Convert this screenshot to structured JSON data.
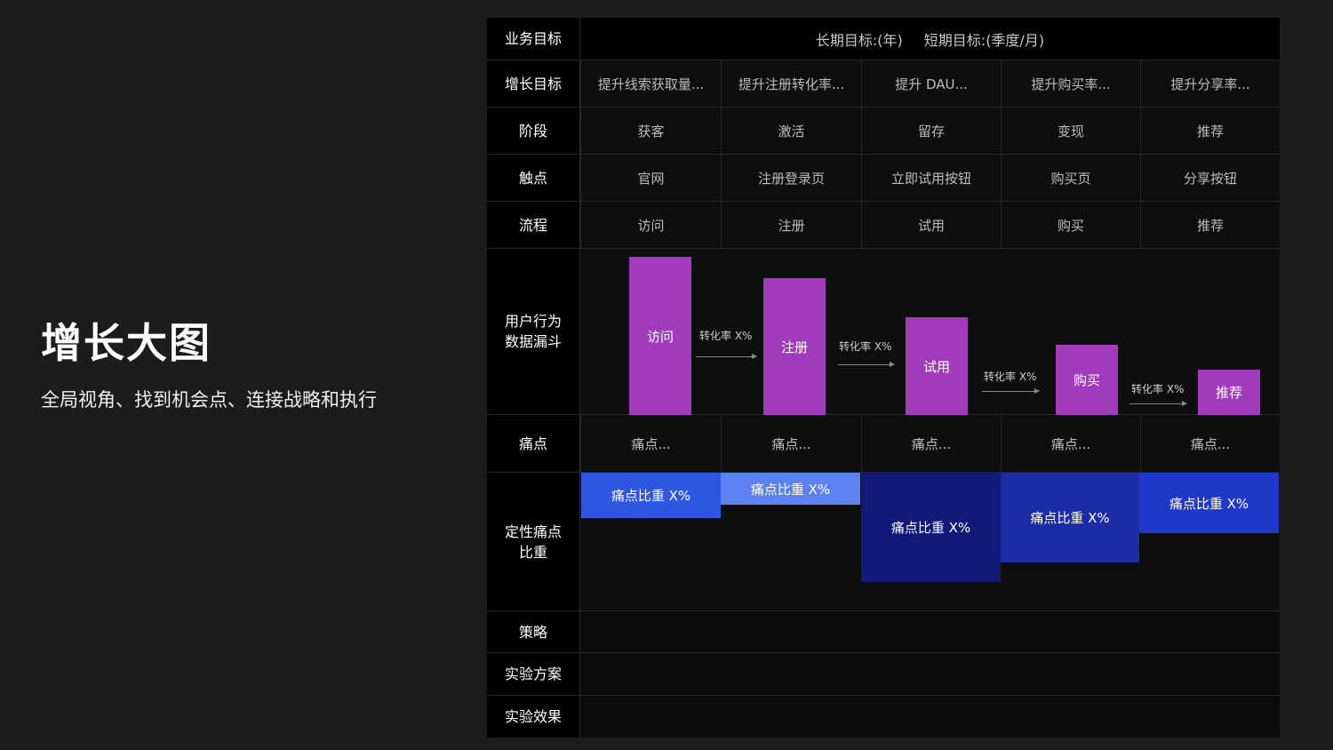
{
  "title": "增长大图",
  "subtitle": "全局视角、找到机会点、连接战略和执行",
  "rows": {
    "biz_goal": {
      "label": "业务目标",
      "long_term": "长期目标:(年)",
      "short_term": "短期目标:(季度/月)"
    },
    "growth_goal": {
      "label": "增长目标",
      "cells": [
        "提升线索获取量...",
        "提升注册转化率...",
        "提升 DAU...",
        "提升购买率...",
        "提升分享率..."
      ]
    },
    "stage": {
      "label": "阶段",
      "cells": [
        "获客",
        "激活",
        "留存",
        "变现",
        "推荐"
      ]
    },
    "touchpoint": {
      "label": "触点",
      "cells": [
        "官网",
        "注册登录页",
        "立即试用按钮",
        "购买页",
        "分享按钮"
      ]
    },
    "flow": {
      "label": "流程",
      "cells": [
        "访问",
        "注册",
        "试用",
        "购买",
        "推荐"
      ]
    },
    "funnel": {
      "label": "用户行为\n数据漏斗",
      "bars": [
        "访问",
        "注册",
        "试用",
        "购买",
        "推荐"
      ],
      "conversion_label": "转化率 X%"
    },
    "pain": {
      "label": "痛点",
      "cells": [
        "痛点...",
        "痛点...",
        "痛点...",
        "痛点...",
        "痛点..."
      ]
    },
    "pain_ratio": {
      "label": "定性痛点\n比重",
      "block_text": "痛点比重 X%"
    },
    "strategy": {
      "label": "策略"
    },
    "experiment_plan": {
      "label": "实验方案"
    },
    "experiment_result": {
      "label": "实验效果"
    }
  },
  "colors": {
    "funnel_bar": "#a23bbb",
    "pain_blocks": [
      "#2f56e0",
      "#5b82f0",
      "#111a78",
      "#1c2ba6",
      "#1e38c9"
    ]
  }
}
